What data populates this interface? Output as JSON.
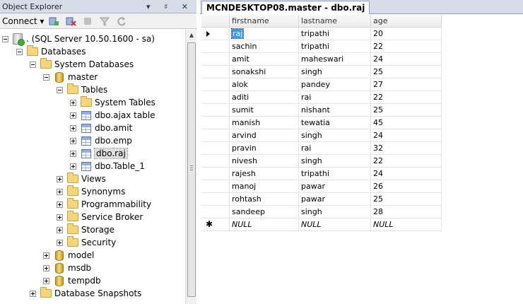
{
  "object_explorer": {
    "title": "Object Explorer",
    "title_controls": "▾ ♯ ✕",
    "toolbar": {
      "connect_label": "Connect ▾"
    },
    "tree": [
      {
        "key": "server",
        "label": ". (SQL Server 10.50.1600 - sa)",
        "icon": "server-icon",
        "expander": "minus",
        "expanded": true
      },
      {
        "key": "databases",
        "label": "Databases",
        "icon": "folder-icon",
        "expander": "minus"
      },
      {
        "key": "system-databases",
        "label": "System Databases",
        "icon": "folder-icon",
        "expander": "minus"
      },
      {
        "key": "master",
        "label": "master",
        "icon": "database-icon",
        "expander": "minus"
      },
      {
        "key": "tables",
        "label": "Tables",
        "icon": "folder-icon",
        "expander": "minus"
      },
      {
        "key": "system-tables",
        "label": "System Tables",
        "icon": "folder-icon",
        "expander": "plus"
      },
      {
        "key": "dbo-ajax-table",
        "label": "dbo.ajax table",
        "icon": "table-icon",
        "expander": "plus"
      },
      {
        "key": "dbo-amit",
        "label": "dbo.amit",
        "icon": "table-icon",
        "expander": "plus"
      },
      {
        "key": "dbo-emp",
        "label": "dbo.emp",
        "icon": "table-icon",
        "expander": "plus"
      },
      {
        "key": "dbo-raj",
        "label": "dbo.raj",
        "icon": "table-icon",
        "expander": "plus",
        "selected": true
      },
      {
        "key": "dbo-table-1",
        "label": "dbo.Table_1",
        "icon": "table-icon",
        "expander": "plus"
      },
      {
        "key": "views",
        "label": "Views",
        "icon": "folder-icon",
        "expander": "plus"
      },
      {
        "key": "synonyms",
        "label": "Synonyms",
        "icon": "folder-icon",
        "expander": "plus"
      },
      {
        "key": "programmability",
        "label": "Programmability",
        "icon": "folder-icon",
        "expander": "plus"
      },
      {
        "key": "service-broker",
        "label": "Service Broker",
        "icon": "folder-icon",
        "expander": "plus"
      },
      {
        "key": "storage",
        "label": "Storage",
        "icon": "folder-icon",
        "expander": "plus"
      },
      {
        "key": "security",
        "label": "Security",
        "icon": "folder-icon",
        "expander": "plus"
      },
      {
        "key": "model",
        "label": "model",
        "icon": "database-icon",
        "expander": "plus"
      },
      {
        "key": "msdb",
        "label": "msdb",
        "icon": "database-icon",
        "expander": "plus"
      },
      {
        "key": "tempdb",
        "label": "tempdb",
        "icon": "database-icon",
        "expander": "plus"
      },
      {
        "key": "database-snapshots",
        "label": "Database Snapshots",
        "icon": "folder-icon",
        "expander": "plus"
      }
    ]
  },
  "document": {
    "tab_label": "MCNDESKTOP08.master - dbo.raj",
    "columns": [
      "firstname",
      "lastname",
      "age"
    ],
    "rows": [
      [
        "raj",
        "tripathi",
        "20"
      ],
      [
        "sachin",
        "tripathi",
        "22"
      ],
      [
        "amit",
        "maheswari",
        "24"
      ],
      [
        "sonakshi",
        "singh",
        "25"
      ],
      [
        "alok",
        "pandey",
        "27"
      ],
      [
        "aditi",
        "rai",
        "22"
      ],
      [
        "sumit",
        "nishant",
        "25"
      ],
      [
        "manish",
        "tewatia",
        "45"
      ],
      [
        "arvind",
        "singh",
        "24"
      ],
      [
        "pravin",
        "rai",
        "32"
      ],
      [
        "nivesh",
        "singh",
        "22"
      ],
      [
        "rajesh",
        "tripathi",
        "24"
      ],
      [
        "manoj",
        "pawar",
        "26"
      ],
      [
        "rohtash",
        "pawar",
        "25"
      ],
      [
        "sandeep",
        "singh",
        "28"
      ]
    ],
    "new_row": [
      "NULL",
      "NULL",
      "NULL"
    ],
    "current_row_index": 0
  }
}
